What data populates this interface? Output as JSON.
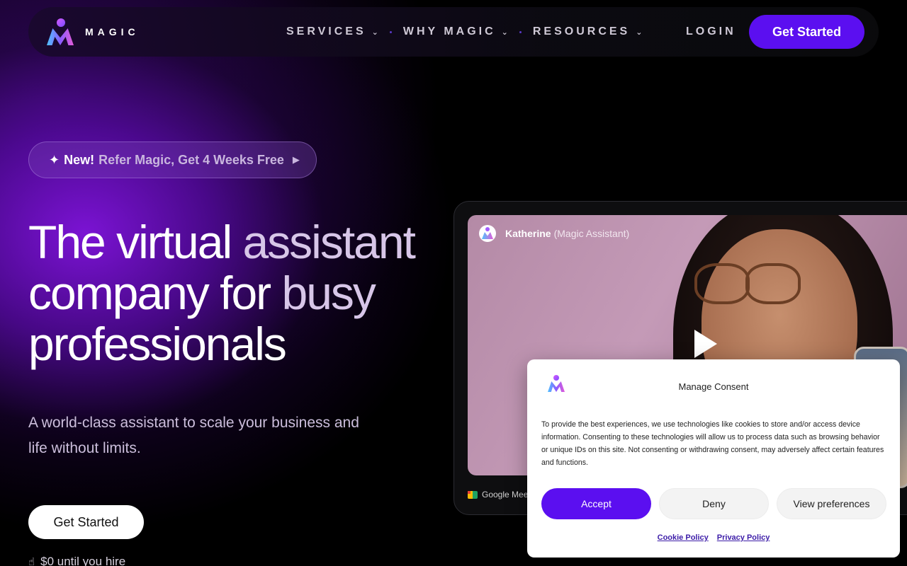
{
  "nav": {
    "brand": "MAGIC",
    "items": [
      {
        "label": "SERVICES"
      },
      {
        "label": "WHY MAGIC"
      },
      {
        "label": "RESOURCES"
      }
    ],
    "login": "LOGIN",
    "cta": "Get Started"
  },
  "promo": {
    "new_label": "New!",
    "text": "Refer Magic, Get 4 Weeks Free"
  },
  "hero": {
    "headline_part1": "The virtual ",
    "headline_part2": "assistant",
    "headline_part3": "company for ",
    "headline_part4": "busy",
    "headline_part5": "professionals",
    "subtitle": "A world-class assistant to scale your business and life without limits.",
    "cta": "Get Started",
    "note": "$0 until you hire"
  },
  "video": {
    "name": "Katherine",
    "role": "(Magic Assistant)",
    "platform": "Google Meet"
  },
  "consent": {
    "title": "Manage Consent",
    "body": "To provide the best experiences, we use technologies like cookies to store and/or access device information. Consenting to these technologies will allow us to process data such as browsing behavior or unique IDs on this site. Not consenting or withdrawing consent, may adversely affect certain features and functions.",
    "accept": "Accept",
    "deny": "Deny",
    "preferences": "View preferences",
    "cookie_policy": "Cookie Policy",
    "privacy_policy": "Privacy Policy"
  },
  "colors": {
    "accent": "#5b0ff0",
    "bg": "#000000"
  }
}
